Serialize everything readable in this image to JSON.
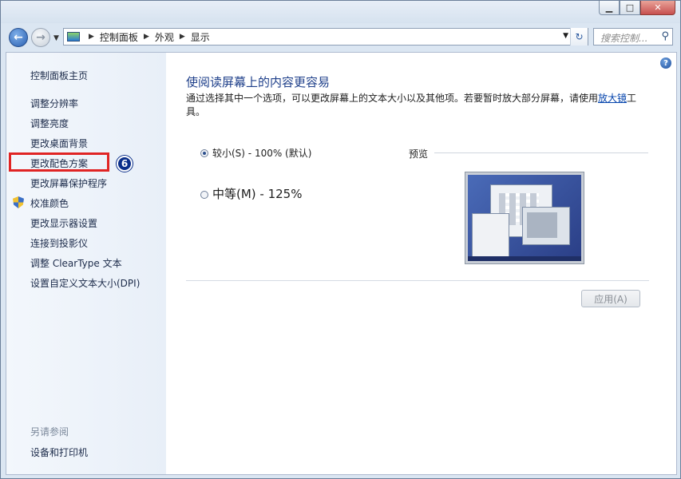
{
  "window": {
    "minimize_icon": "minimize-icon",
    "maximize_icon": "maximize-icon",
    "close_icon": "close-icon"
  },
  "navbar": {
    "breadcrumbs": [
      "控制面板",
      "外观",
      "显示"
    ],
    "search_placeholder": "搜索控制..."
  },
  "sidebar": {
    "home": "控制面板主页",
    "items": [
      {
        "label": "调整分辨率"
      },
      {
        "label": "调整亮度"
      },
      {
        "label": "更改桌面背景"
      },
      {
        "label": "更改配色方案"
      },
      {
        "label": "更改屏幕保护程序"
      },
      {
        "label": "校准颜色",
        "icon": "shield-icon"
      },
      {
        "label": "更改显示器设置"
      },
      {
        "label": "连接到投影仪"
      },
      {
        "label": "调整 ClearType 文本"
      },
      {
        "label": "设置自定义文本大小(DPI)"
      }
    ],
    "see_also": "另请参阅",
    "see_also_items": [
      "设备和打印机"
    ],
    "highlight_badge": "6"
  },
  "main": {
    "heading": "使阅读屏幕上的内容更容易",
    "description_prefix": "通过选择其中一个选项，可以更改屏幕上的文本大小以及其他项。若要暂时放大部分屏幕，请使用",
    "description_link": "放大镜",
    "description_suffix": "工具。",
    "options": [
      {
        "label": "较小(S) - 100% (默认)",
        "selected": true
      },
      {
        "label": "中等(M) - 125%",
        "selected": false
      }
    ],
    "preview_label": "预览",
    "apply_button": "应用(A)"
  },
  "colors": {
    "accent_heading": "#1e3f8a",
    "highlight_box": "#e02424",
    "badge": "#0b2f8a"
  }
}
